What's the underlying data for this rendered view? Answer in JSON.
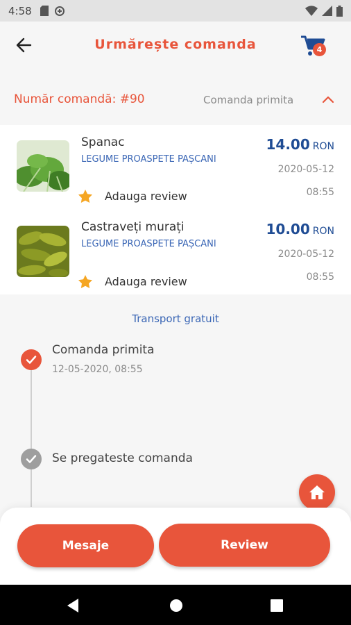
{
  "status_bar": {
    "time": "4:58"
  },
  "header": {
    "title": "Urmărește comanda",
    "cart_count": "4",
    "back_icon": "arrow-left-icon",
    "cart_icon": "cart-icon"
  },
  "order": {
    "number_label": "Număr comandă: #90",
    "status": "Comanda primita",
    "toggle_icon": "chevron-up-icon"
  },
  "products": [
    {
      "name": "Spanac",
      "vendor": "LEGUME PROASPETE PAȘCANI",
      "price": "14.00",
      "currency": "RON",
      "date": "2020-05-12",
      "time": "08:55",
      "review_label": "Adauga review"
    },
    {
      "name": "Castraveți murați",
      "vendor": "LEGUME PROASPETE PAȘCANI",
      "price": "10.00",
      "currency": "RON",
      "date": "2020-05-12",
      "time": "08:55",
      "review_label": "Adauga review"
    }
  ],
  "transport": "Transport gratuit",
  "timeline": [
    {
      "title": "Comanda primita",
      "date": "12-05-2020, 08:55",
      "done": true
    },
    {
      "title": "Se pregateste comanda",
      "done": false
    }
  ],
  "actions": {
    "messages_label": "Mesaje",
    "review_label": "Review"
  },
  "colors": {
    "accent": "#e8553b",
    "price": "#1f4c94",
    "vendor": "#3a66b5",
    "star": "#f5a623",
    "pending": "#9e9e9e"
  }
}
